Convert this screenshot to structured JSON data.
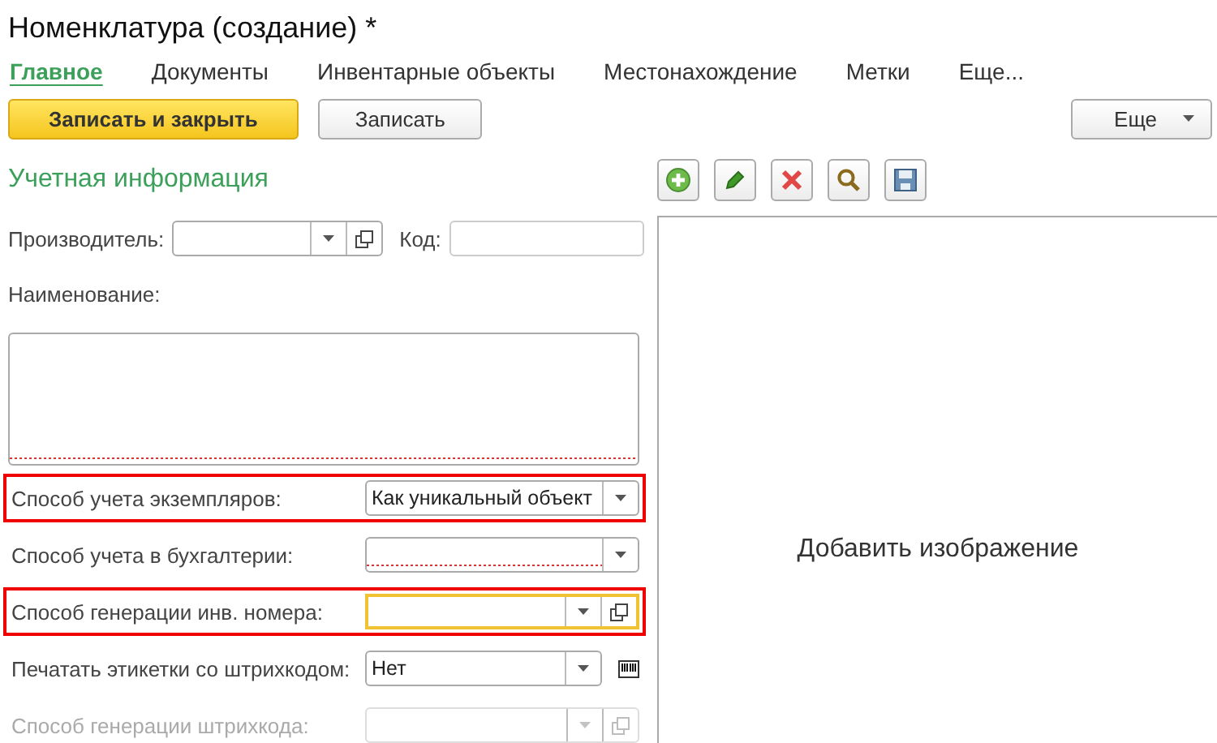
{
  "window": {
    "title": "Номенклатура (создание) *"
  },
  "tabs": [
    {
      "label": "Главное",
      "selected": true
    },
    {
      "label": "Документы",
      "selected": false
    },
    {
      "label": "Инвентарные объекты",
      "selected": false
    },
    {
      "label": "Местонахождение",
      "selected": false
    },
    {
      "label": "Метки",
      "selected": false
    },
    {
      "label": "Еще...",
      "selected": false
    }
  ],
  "buttons": [
    {
      "label": "Записать и закрыть",
      "kind": "primary"
    },
    {
      "label": "Записать",
      "kind": "normal"
    }
  ],
  "more_button": {
    "label": "Еще"
  },
  "section_title": "Учетная информация",
  "producer": {
    "label": "Производитель:"
  },
  "code": {
    "label": "Код:"
  },
  "name_field": {
    "label": "Наименование:",
    "required": true
  },
  "fields": [
    {
      "label": "Способ учета экземпляров:",
      "value": "Как уникальный объект",
      "highlighted": true,
      "required": false,
      "focused": false,
      "disabled": false,
      "open_button": false,
      "barcode_button": false
    },
    {
      "label": "Способ учета в бухгалтерии:",
      "highlighted": false,
      "required": true,
      "focused": false,
      "disabled": false,
      "open_button": false,
      "barcode_button": false
    },
    {
      "label": "Способ генерации инв. номера:",
      "highlighted": true,
      "required": false,
      "focused": true,
      "disabled": false,
      "open_button": true,
      "barcode_button": false
    },
    {
      "label": "Печатать этикетки со штрихкодом:",
      "value": "Нет",
      "highlighted": false,
      "required": false,
      "focused": false,
      "disabled": false,
      "open_button": false,
      "barcode_button": true
    },
    {
      "label": "Способ генерации штрихкода:",
      "highlighted": false,
      "required": false,
      "focused": false,
      "disabled": true,
      "open_button": true,
      "barcode_button": false
    }
  ],
  "image_panel": {
    "text": "Добавить изображение"
  }
}
